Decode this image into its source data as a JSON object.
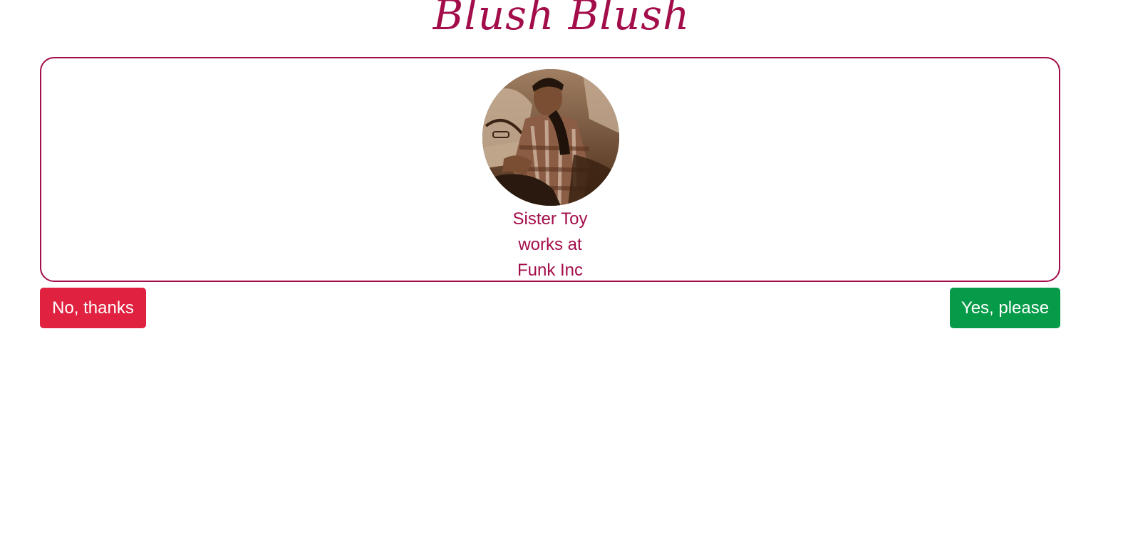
{
  "app": {
    "title": "Blush Blush"
  },
  "profile": {
    "name": "Sister Toy",
    "works_at_label": "works at",
    "company": "Funk Inc",
    "avatar_icon": "profile-photo"
  },
  "actions": {
    "reject_label": "No, thanks",
    "accept_label": "Yes, please"
  },
  "colors": {
    "brand": "#a30d4a",
    "reject": "#e0213f",
    "accept": "#069b48"
  }
}
